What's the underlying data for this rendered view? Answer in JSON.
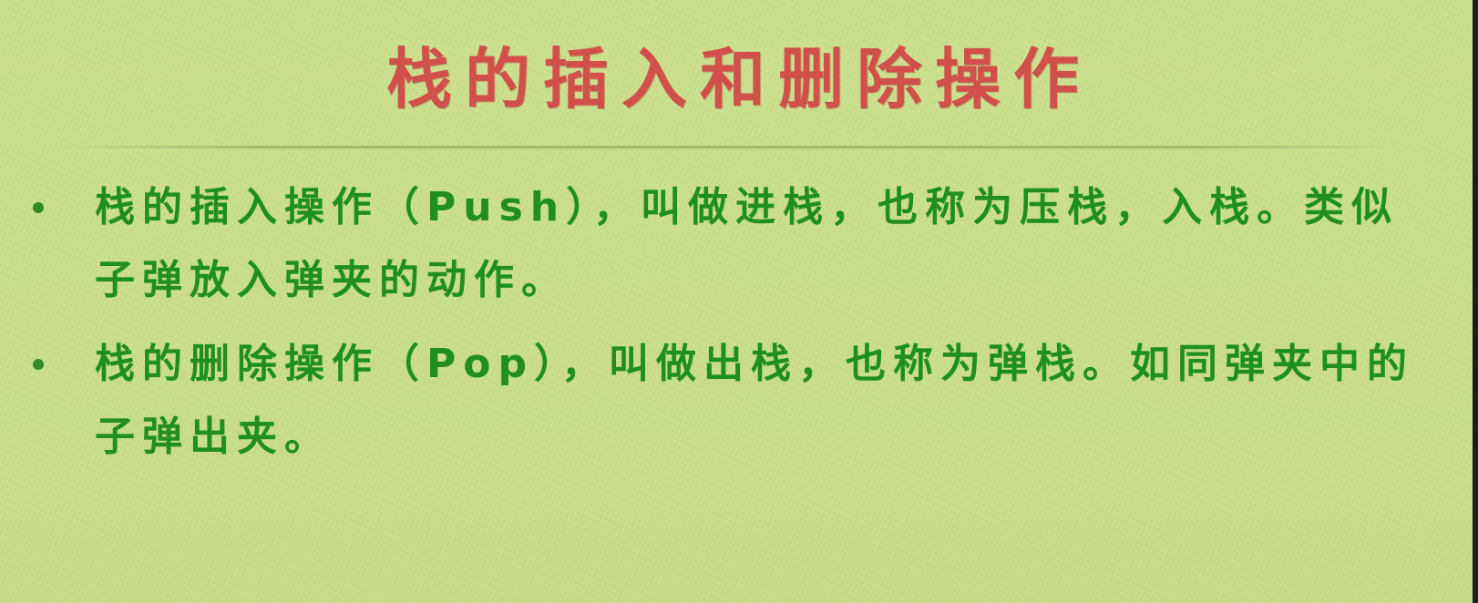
{
  "slide": {
    "title": "栈的插入和删除操作",
    "bullets": [
      {
        "text": "栈的插入操作（Push），叫做进栈，也称为压栈，入栈。类似子弹放入弹夹的动作。"
      },
      {
        "text": "栈的删除操作（Pop），叫做出栈，也称为弹栈。如同弹夹中的子弹出夹。"
      }
    ]
  },
  "colors": {
    "background": "#c8dc8a",
    "title": "#d2504a",
    "body_text": "#1f8f1f"
  }
}
